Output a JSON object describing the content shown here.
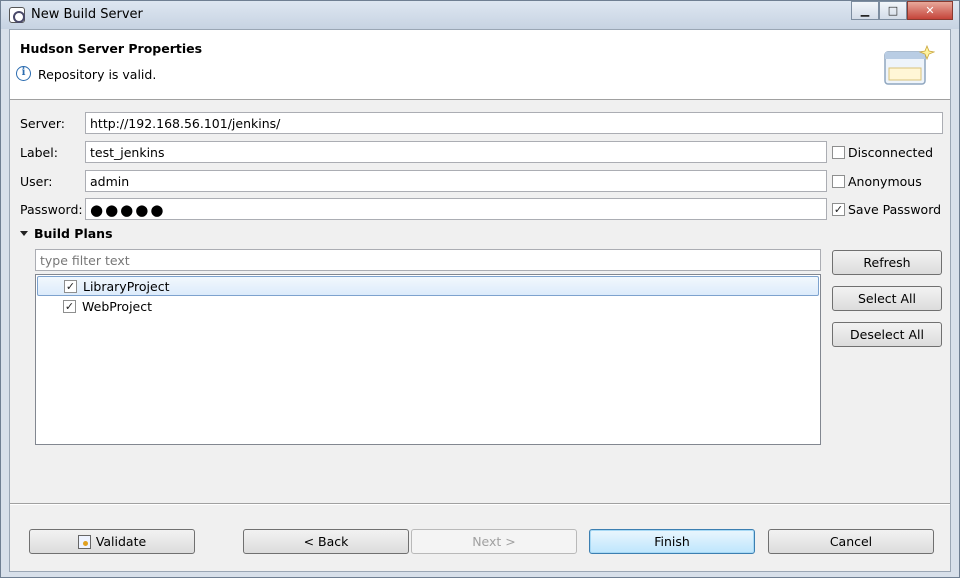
{
  "window": {
    "title": "New Build Server"
  },
  "banner": {
    "title": "Hudson Server Properties",
    "message": "Repository is valid."
  },
  "form": {
    "server": {
      "label": "Server:",
      "value": "http://192.168.56.101/jenkins/"
    },
    "label": {
      "label": "Label:",
      "value": "test_jenkins"
    },
    "user": {
      "label": "User:",
      "value": "admin"
    },
    "password": {
      "label": "Password:",
      "value": "●●●●●"
    },
    "disconnected": {
      "label": "Disconnected",
      "checked": false
    },
    "anonymous": {
      "label": "Anonymous",
      "checked": false
    },
    "save_password": {
      "label": "Save Password",
      "checked": true
    }
  },
  "build_plans": {
    "title": "Build Plans",
    "filter_placeholder": "type filter text",
    "items": [
      {
        "label": "LibraryProject",
        "checked": true,
        "selected": true
      },
      {
        "label": "WebProject",
        "checked": true,
        "selected": false
      }
    ],
    "buttons": {
      "refresh": "Refresh",
      "select_all": "Select All",
      "deselect_all": "Deselect All"
    }
  },
  "footer": {
    "validate": "Validate",
    "back": "< Back",
    "next": "Next >",
    "finish": "Finish",
    "cancel": "Cancel"
  },
  "check_mark": "✓"
}
